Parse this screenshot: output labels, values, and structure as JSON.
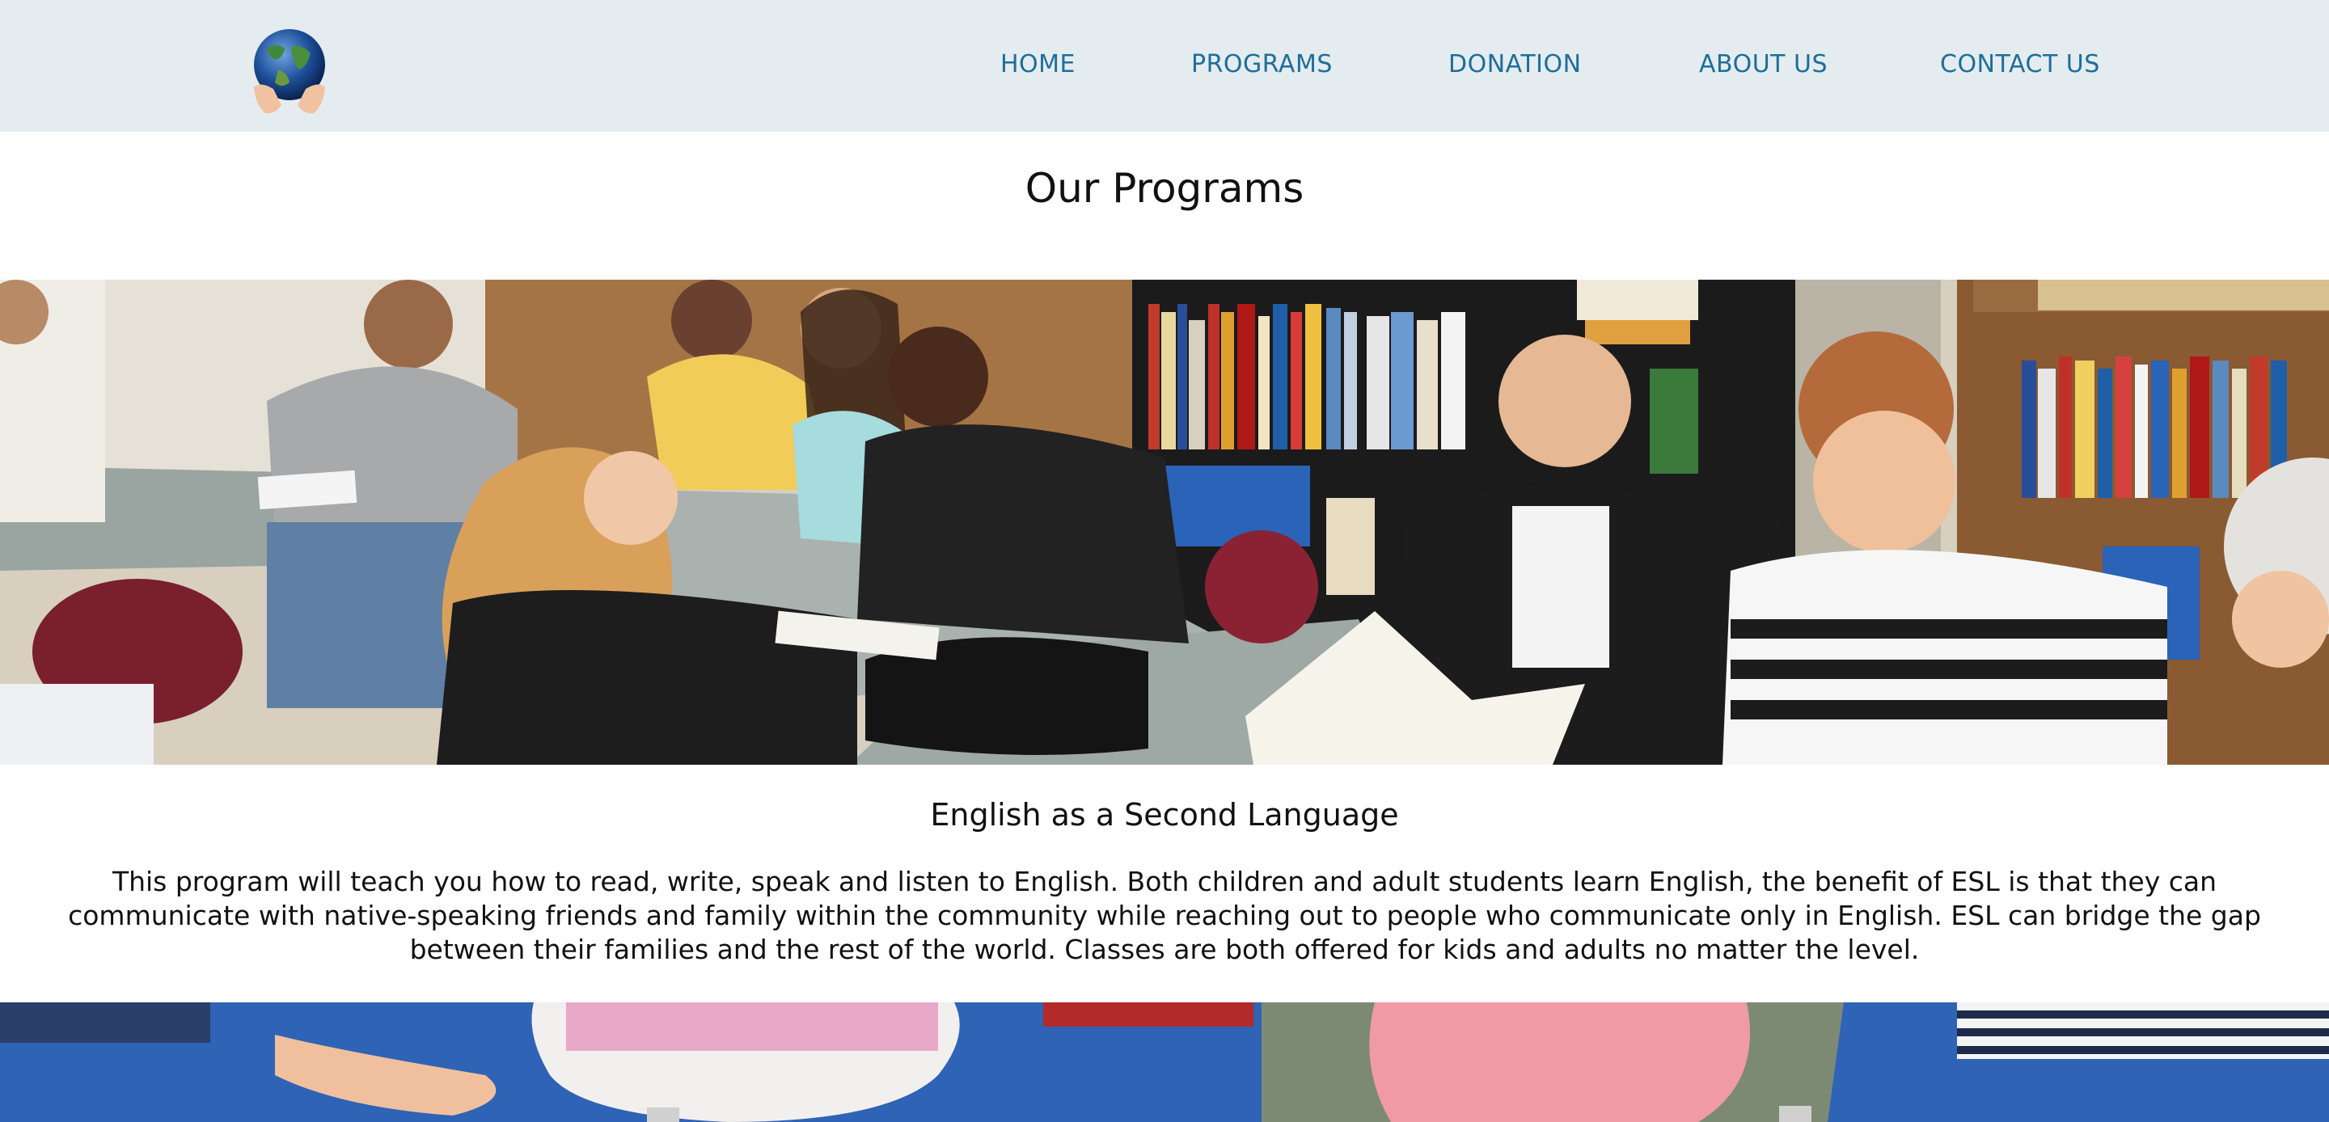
{
  "nav": {
    "items": [
      {
        "label": "HOME"
      },
      {
        "label": "PROGRAMS"
      },
      {
        "label": "DONATION"
      },
      {
        "label": "ABOUT US"
      },
      {
        "label": "CONTACT US"
      }
    ]
  },
  "colors": {
    "header_bg": "#e4ecef",
    "nav_link": "#1e6e99"
  },
  "page": {
    "title": "Our Programs"
  },
  "program": {
    "title": "English as a Second Language",
    "description": "This program will teach you how to read, write, speak and listen to English. Both children and adult students learn English, the benefit of ESL is that they can communicate with native-speaking friends and family within the community while reaching out to people who communicate only in English. ESL can bridge the gap between their families and the rest of the world. Classes are both offered for kids and adults no matter the level."
  }
}
